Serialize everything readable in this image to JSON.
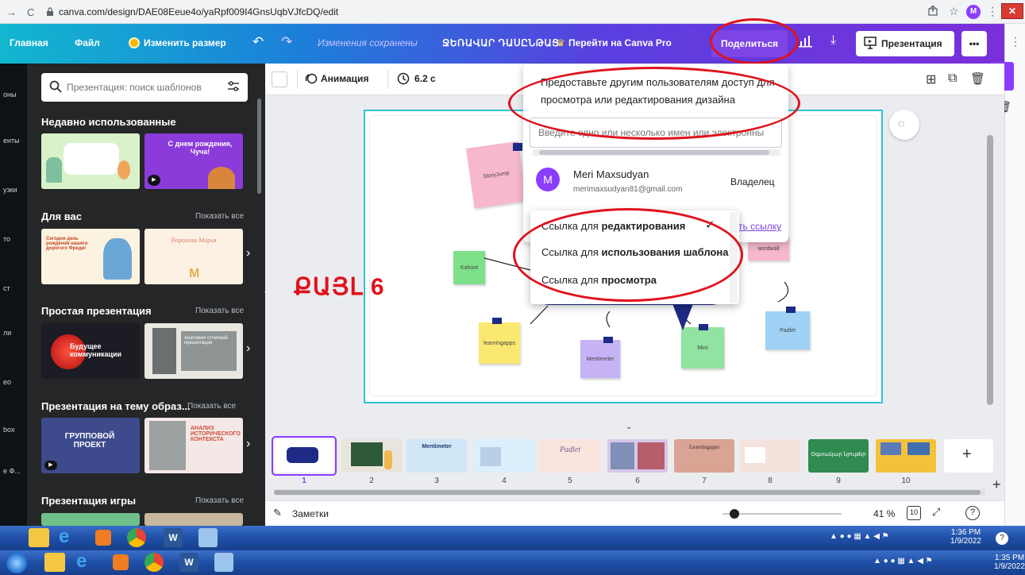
{
  "browser": {
    "back": "→",
    "reload": "C",
    "url": "canva.com/design/DAE08Eeue4o/yaRpf009I4GnsUqbVJfcDQ/edit",
    "avatar_letter": "M"
  },
  "topbar": {
    "home": "Главная",
    "file": "Файл",
    "resize": "Изменить размер",
    "saved": "Изменения сохранены",
    "design_title": "ՋԵՌԱՎԱՐ ԴԱՍԸՆԹԱՑ",
    "pro": "Перейти на Canva Pro",
    "share": "Поделиться",
    "present": "Презентация",
    "more": "•••"
  },
  "rail": {
    "labels": [
      "оны",
      "енты",
      "узки",
      "то",
      "ст",
      "ли",
      "ео",
      "box",
      "е Ф..."
    ]
  },
  "panel": {
    "search_placeholder": "Презентация: поиск шаблонов",
    "sections": [
      {
        "title": "Недавно использованные",
        "show_all": ""
      },
      {
        "title": "Для вас",
        "show_all": "Показать все"
      },
      {
        "title": "Простая презентация",
        "show_all": "Показать все"
      },
      {
        "title": "Презентация на тему образ...",
        "show_all": "Показать все"
      },
      {
        "title": "Презентация игры",
        "show_all": "Показать все"
      }
    ],
    "thumb_texts": {
      "birthday": "С днем рождения, Чуча!",
      "forYou1": "Сегодня день рождения нашего дорогого Фреди!",
      "forYou2": "Воронова Марья",
      "future": "Будущее коммуникации",
      "anatomy": "Анатомия отличной презентации",
      "group": "ГРУППОВОЙ ПРОЕКТ",
      "analysis": "АНАЛИЗ ИСТОРИЧЕСКОГО КОНТЕКСТА"
    }
  },
  "editor_toolbar": {
    "animation": "Анимация",
    "duration": "6.2 с"
  },
  "slide": {
    "big_label": "ՔԱՅԼ 6",
    "notes": {
      "storyjump": "StoryJump",
      "kahoot": "Kahoot",
      "learningapps": "learningapps",
      "mentimeter": "Mentimeter",
      "wordwall": "wordwall",
      "padlet": "Padlet",
      "miro": "Miro"
    }
  },
  "share_popup": {
    "heading": "Предоставьте другим пользователям доступ для просмотра или редактирования дизайна",
    "input_placeholder": "Введите одно или несколько имен или электронны",
    "user_initial": "M",
    "user_name": "Meri Maxsudyan",
    "user_email": "merimaxsudyan81@gmail.com",
    "user_role": "Владелец",
    "copy_link_tail": "ть ссылку",
    "dropdown": [
      {
        "prefix": "Ссылка для ",
        "bold": "редактирования",
        "checked": true
      },
      {
        "prefix": "Ссылка для ",
        "bold": "использования шаблона",
        "checked": false
      },
      {
        "prefix": "Ссылка для ",
        "bold": "просмотра",
        "checked": false
      }
    ]
  },
  "pages": {
    "numbers": [
      "1",
      "2",
      "3",
      "4",
      "5",
      "6",
      "7",
      "8",
      "9",
      "10"
    ],
    "thumb_texts": [
      "",
      "",
      "Mentimeter",
      "",
      "Padlet",
      "",
      "Learningapps",
      "",
      "Օգտակար նյութեր",
      ""
    ],
    "add": "+"
  },
  "bottombar": {
    "notes": "Заметки",
    "zoom": "41 %",
    "page_count": "10",
    "help": "?"
  },
  "taskbar_top": {
    "time": "1:36 PM",
    "date": "1/9/2022"
  },
  "taskbar_bottom": {
    "time": "1:35 PM",
    "date": "1/9/2022"
  },
  "colors": {
    "accent": "#8b3dff",
    "ellipse": "#e0121c",
    "slide_border": "#2ec4d6",
    "big_label": "#e0121c"
  }
}
